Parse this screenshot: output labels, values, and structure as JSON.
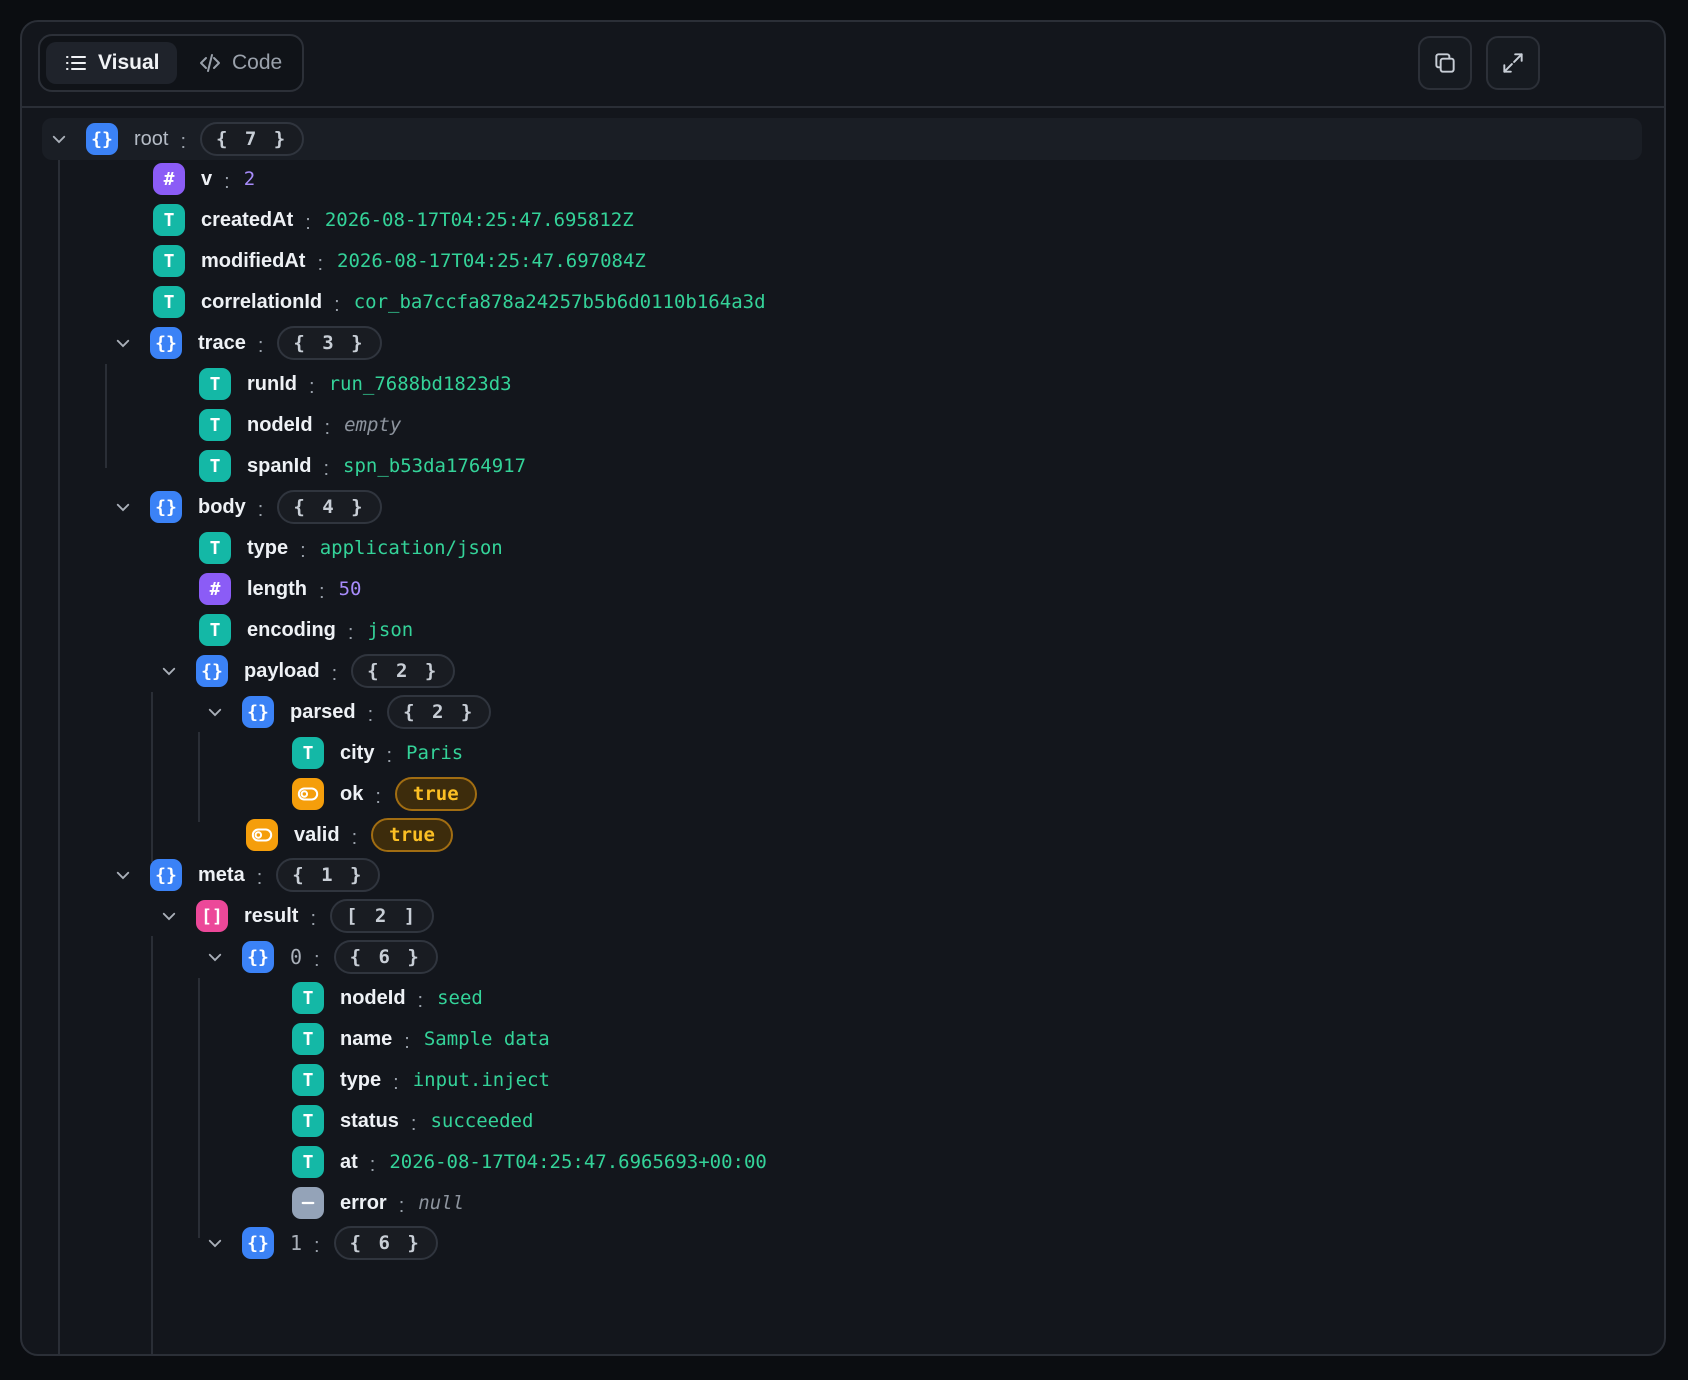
{
  "tabs": {
    "visual": "Visual",
    "code": "Code"
  },
  "actions": {
    "copy_icon": "copy-icon",
    "expand_icon": "expand-icon"
  },
  "tree": {
    "root": {
      "key": "root",
      "count": "{ 7 }"
    },
    "v": {
      "key": "v",
      "value": "2"
    },
    "createdAt": {
      "key": "createdAt",
      "value": "2026-08-17T04:25:47.695812Z"
    },
    "modifiedAt": {
      "key": "modifiedAt",
      "value": "2026-08-17T04:25:47.697084Z"
    },
    "correlationId": {
      "key": "correlationId",
      "value": "cor_ba7ccfa878a24257b5b6d0110b164a3d"
    },
    "trace": {
      "key": "trace",
      "count": "{ 3 }",
      "runId": {
        "key": "runId",
        "value": "run_7688bd1823d3"
      },
      "nodeId": {
        "key": "nodeId",
        "value": "empty"
      },
      "spanId": {
        "key": "spanId",
        "value": "spn_b53da1764917"
      }
    },
    "body": {
      "key": "body",
      "count": "{ 4 }",
      "type": {
        "key": "type",
        "value": "application/json"
      },
      "length": {
        "key": "length",
        "value": "50"
      },
      "encoding": {
        "key": "encoding",
        "value": "json"
      },
      "payload": {
        "key": "payload",
        "count": "{ 2 }",
        "parsed": {
          "key": "parsed",
          "count": "{ 2 }",
          "city": {
            "key": "city",
            "value": "Paris"
          },
          "ok": {
            "key": "ok",
            "value": "true"
          }
        },
        "valid": {
          "key": "valid",
          "value": "true"
        }
      }
    },
    "meta": {
      "key": "meta",
      "count": "{ 1 }",
      "result": {
        "key": "result",
        "count": "[ 2 ]",
        "item0": {
          "key": "0",
          "count": "{ 6 }",
          "nodeId": {
            "key": "nodeId",
            "value": "seed"
          },
          "name": {
            "key": "name",
            "value": "Sample data"
          },
          "type": {
            "key": "type",
            "value": "input.inject"
          },
          "status": {
            "key": "status",
            "value": "succeeded"
          },
          "at": {
            "key": "at",
            "value": "2026-08-17T04:25:47.6965693+00:00"
          },
          "error": {
            "key": "error",
            "value": "null"
          }
        },
        "item1": {
          "key": "1",
          "count": "{ 6 }"
        }
      }
    }
  }
}
